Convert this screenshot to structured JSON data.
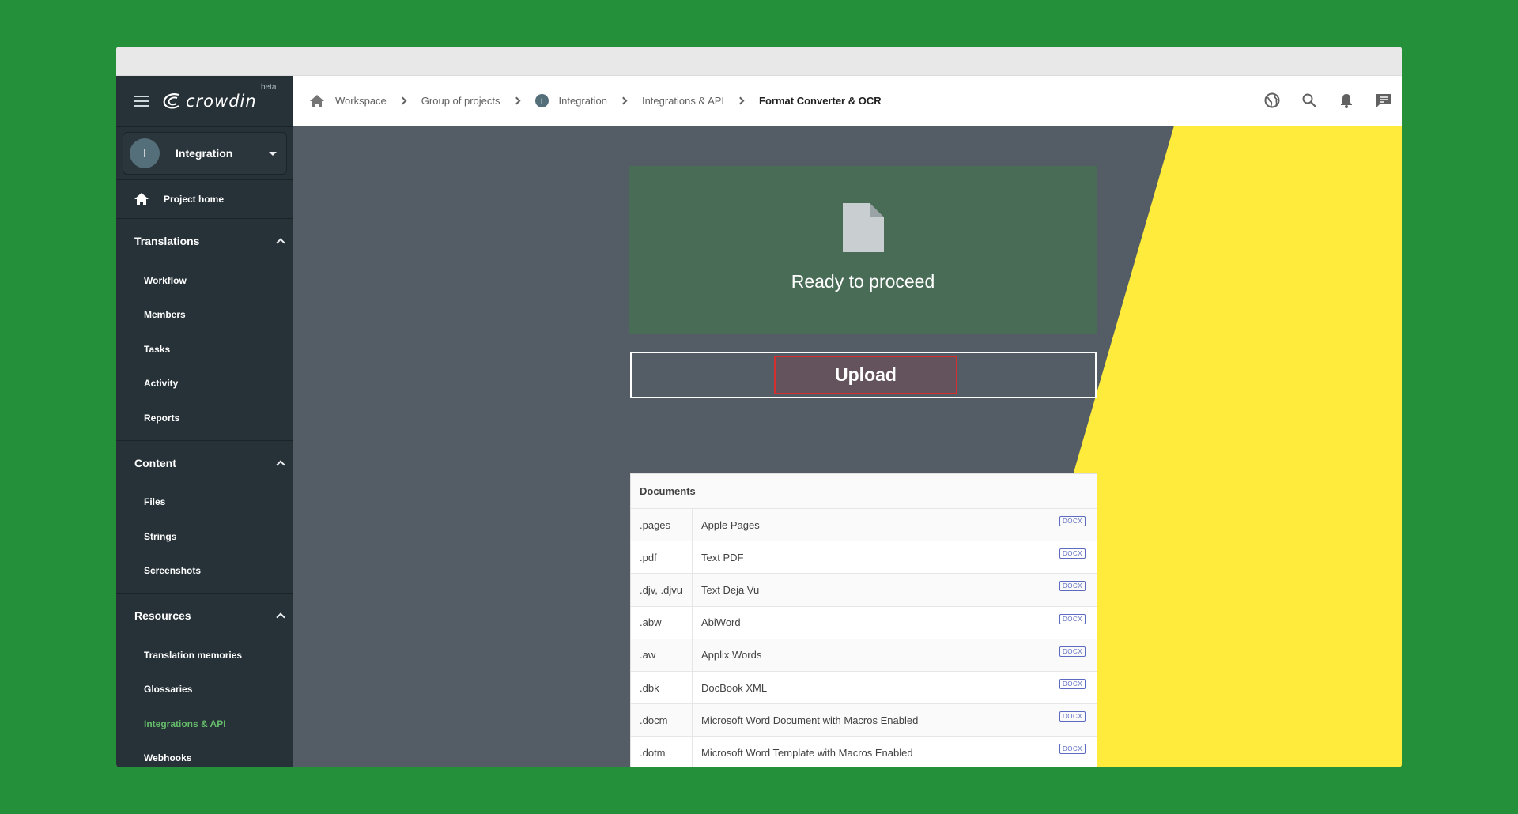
{
  "sidebar": {
    "logo_text": "crowdin",
    "beta_label": "beta",
    "project": {
      "avatar_letter": "I",
      "name": "Integration"
    },
    "home_label": "Project home",
    "sections": [
      {
        "title": "Translations",
        "items": [
          "Workflow",
          "Members",
          "Tasks",
          "Activity",
          "Reports"
        ]
      },
      {
        "title": "Content",
        "items": [
          "Files",
          "Strings",
          "Screenshots"
        ]
      },
      {
        "title": "Resources",
        "items": [
          "Translation memories",
          "Glossaries",
          "Integrations & API",
          "Webhooks"
        ]
      }
    ],
    "active_item": "Integrations & API",
    "active_color": "#66bb6a"
  },
  "breadcrumb": [
    "Workspace",
    "Group of projects",
    "Integration",
    "Integrations & API",
    "Format Converter & OCR"
  ],
  "top_icons": [
    "globe-icon",
    "search-icon",
    "bell-icon",
    "chat-icon"
  ],
  "main": {
    "ready_text": "Ready to proceed",
    "upload_label": "Upload",
    "documents_title": "Documents",
    "documents": [
      {
        "ext": ".pages",
        "name": "Apple Pages",
        "format": "DOCX"
      },
      {
        "ext": ".pdf",
        "name": "Text PDF",
        "format": "DOCX"
      },
      {
        "ext": ".djv, .djvu",
        "name": "Text Deja Vu",
        "format": "DOCX"
      },
      {
        "ext": ".abw",
        "name": "AbiWord",
        "format": "DOCX"
      },
      {
        "ext": ".aw",
        "name": "Applix Words",
        "format": "DOCX"
      },
      {
        "ext": ".dbk",
        "name": "DocBook XML",
        "format": "DOCX"
      },
      {
        "ext": ".docm",
        "name": "Microsoft Word Document with Macros Enabled",
        "format": "DOCX"
      },
      {
        "ext": ".dotm",
        "name": "Microsoft Word Template with Macros Enabled",
        "format": "DOCX"
      }
    ]
  },
  "colors": {
    "background": "#24913a",
    "sidebar": "#263238",
    "accent_yellow": "#ffeb3b",
    "badge": "#5c6bc0"
  }
}
